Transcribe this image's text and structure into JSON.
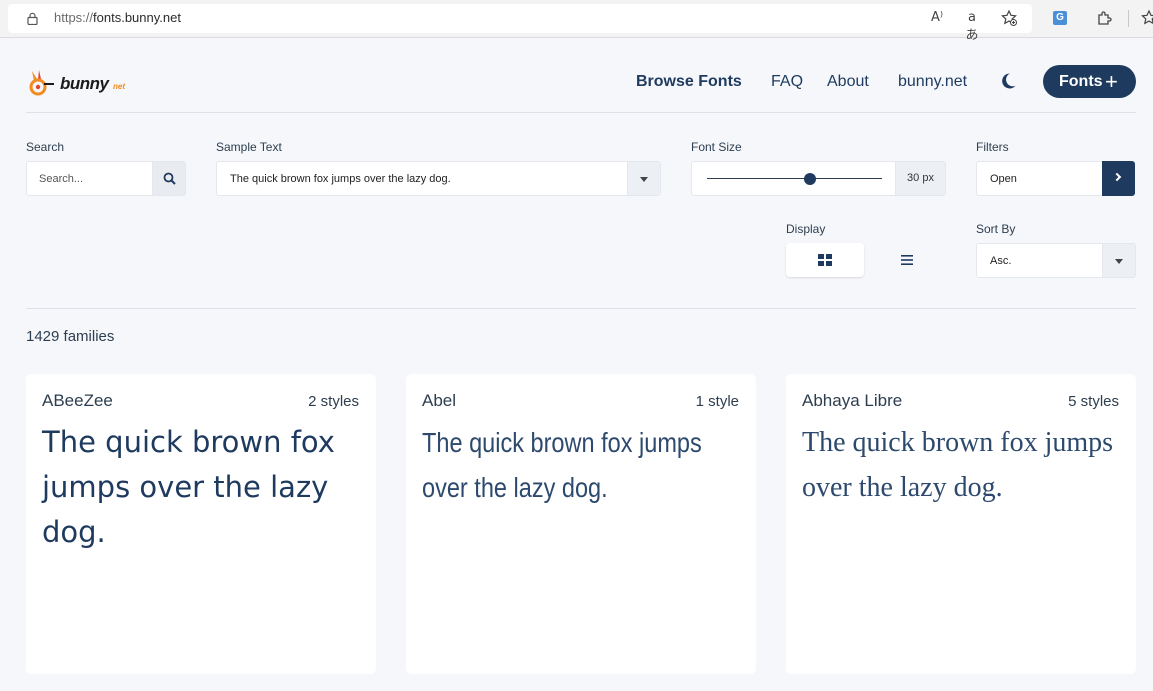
{
  "browser": {
    "url_scheme": "https://",
    "url_host": "fonts.bunny.net",
    "icons": [
      "lock-icon",
      "read-aloud-icon",
      "translate-icon",
      "favorites-icon",
      "extension-g-icon",
      "extensions-puzzle-icon",
      "favorites-star-icon"
    ],
    "ext_letter": "G",
    "read_aloud_glyph": "A⁾",
    "translate_glyph": "aあ"
  },
  "header": {
    "logo_text": "bunny",
    "logo_suffix": "net",
    "nav": {
      "browse": "Browse Fonts",
      "faq": "FAQ",
      "about": "About",
      "bunny": "bunny.net"
    },
    "fonts_button": "Fonts",
    "fonts_button_icon": "+"
  },
  "controls": {
    "search_label": "Search",
    "search_placeholder": "Search...",
    "sample_label": "Sample Text",
    "sample_value": "The quick brown fox jumps over the lazy dog.",
    "size_label": "Font Size",
    "size_value": "30 px",
    "size_slider_fraction": 0.59,
    "filters_label": "Filters",
    "filters_value": "Open",
    "display_label": "Display",
    "sort_label": "Sort By",
    "sort_value": "Asc."
  },
  "results": {
    "count_text": "1429 families"
  },
  "cards": [
    {
      "name": "ABeeZee",
      "styles": "2 styles",
      "sample": "The quick brown fox jumps over the lazy dog."
    },
    {
      "name": "Abel",
      "styles": "1 style",
      "sample": "The quick brown fox jumps over the lazy dog."
    },
    {
      "name": "Abhaya Libre",
      "styles": "5 styles",
      "sample": "The quick brown fox jumps over the lazy dog."
    }
  ],
  "colors": {
    "brand_navy": "#1e3a5f",
    "logo_orange": "#f28b20",
    "page_bg": "#f5f7fa"
  }
}
